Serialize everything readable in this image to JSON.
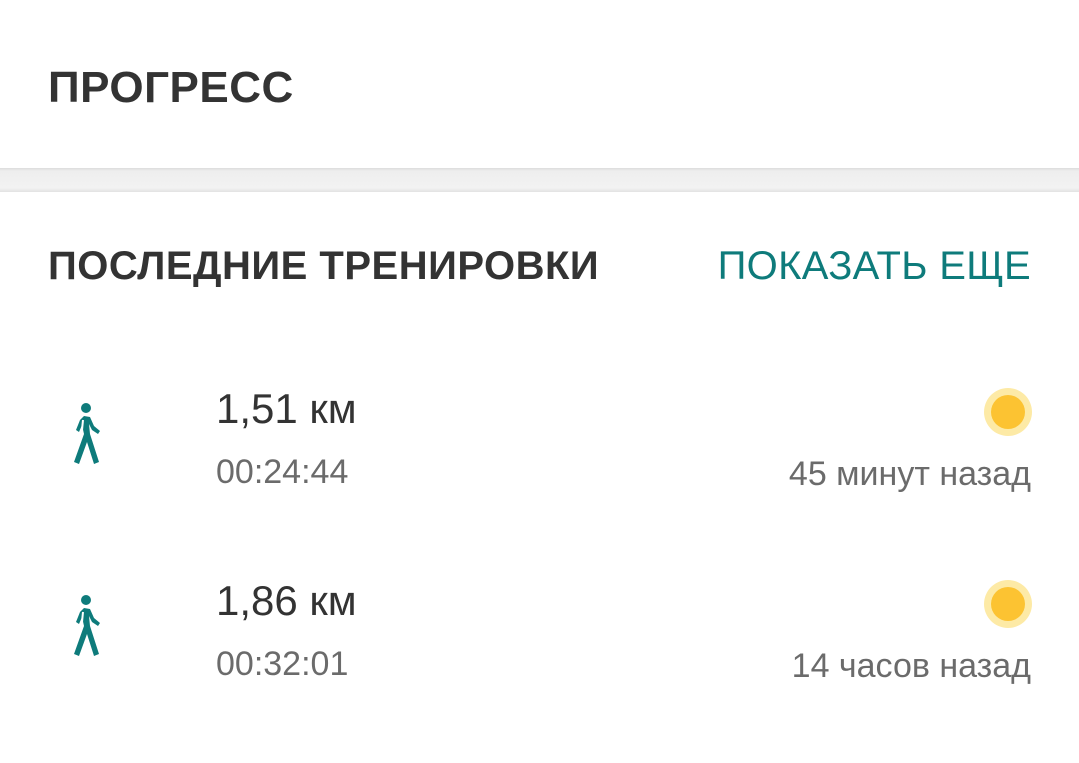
{
  "header": {
    "title": "ПРОГРЕСС"
  },
  "recent": {
    "title": "ПОСЛЕДНИЕ ТРЕНИРОВКИ",
    "show_more_label": "ПОКАЗАТЬ ЕЩЕ",
    "workouts": [
      {
        "activity_icon": "walking-icon",
        "distance": "1,51 км",
        "duration": "00:24:44",
        "weather_icon": "sun-icon",
        "time_ago": "45 минут назад"
      },
      {
        "activity_icon": "walking-icon",
        "distance": "1,86 км",
        "duration": "00:32:01",
        "weather_icon": "sun-icon",
        "time_ago": "14 часов назад"
      }
    ]
  },
  "colors": {
    "accent": "#0e7b7b",
    "title_text": "#333333",
    "secondary_text": "#6b6b6b",
    "sun": "#fcc332",
    "sun_halo": "#fdeaa6"
  }
}
